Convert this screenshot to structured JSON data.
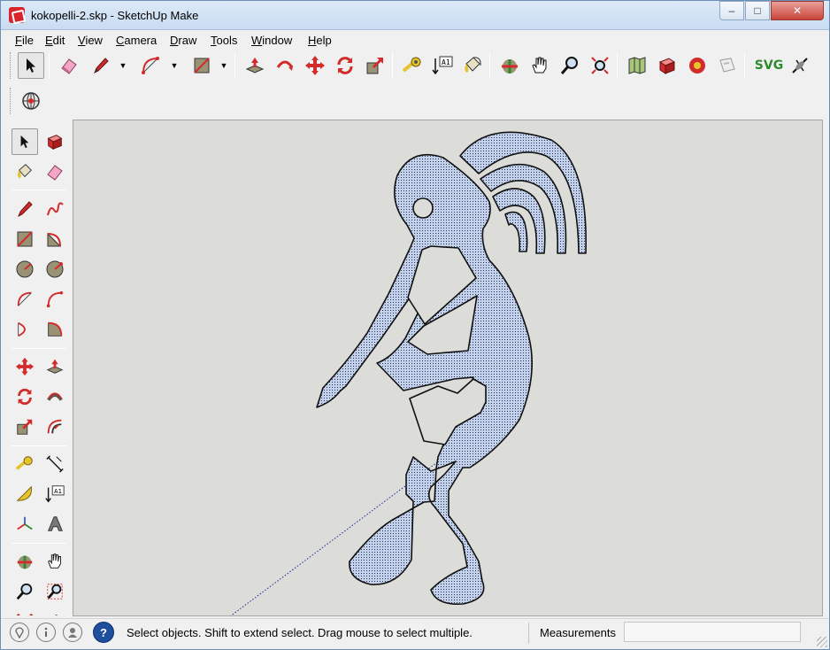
{
  "window": {
    "title": "kokopelli-2.skp - SketchUp Make",
    "min_glyph": "–",
    "max_glyph": "□",
    "close_glyph": "✕"
  },
  "menu": {
    "items": [
      {
        "ul": "F",
        "rest": "ile"
      },
      {
        "ul": "E",
        "rest": "dit"
      },
      {
        "ul": "V",
        "rest": "iew"
      },
      {
        "ul": "C",
        "rest": "amera"
      },
      {
        "ul": "D",
        "rest": "raw"
      },
      {
        "ul": "T",
        "rest": "ools"
      },
      {
        "ul": "W",
        "rest": "indow"
      },
      {
        "ul": "H",
        "rest": "elp"
      }
    ]
  },
  "toolbar": {
    "svg_label": "SVG",
    "dimension_text": "A1",
    "buttons": [
      "select-icon",
      "eraser-icon",
      "pencil-line-icon",
      "arc-icon",
      "rectangle-icon",
      "push-pull-icon",
      "follow-me-icon",
      "move-icon",
      "rotate-icon",
      "scale-icon",
      "tape-measure-icon",
      "text-icon",
      "paint-bucket-icon",
      "orbit-icon",
      "pan-icon",
      "zoom-icon",
      "zoom-extents-icon",
      "map-icon",
      "3d-warehouse-icon",
      "extension-warehouse-icon",
      "layout-icon",
      "svg-export-icon",
      "bug-icon",
      "geo-location-icon"
    ]
  },
  "left_toolbar": {
    "text_label": "A1"
  },
  "status": {
    "hint": "Select objects. Shift to extend select. Drag mouse to select multiple.",
    "measurements_label": "Measurements",
    "measurements_value": ""
  },
  "colors": {
    "viewport_bg": "#dcdcd9",
    "model_fill": "#c3d1ea",
    "model_stroke": "#1a1a1a",
    "accent_red": "#d22b2b"
  }
}
